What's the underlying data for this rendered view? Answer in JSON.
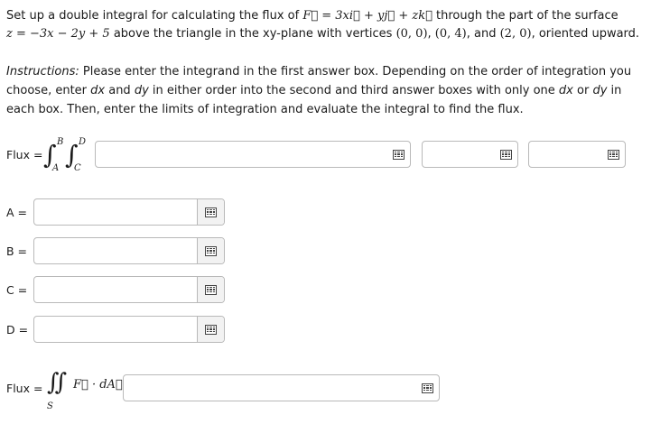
{
  "problem": {
    "line1_pre": "Set up a double integral for calculating the flux of ",
    "line1_field": "F⃗ = 3xi⃗ + yj⃗ + zk⃗",
    "line1_post": " through the part of the surface",
    "line2_eq": "z = −3x − 2y + 5",
    "line2_mid": " above the triangle in the xy-plane with vertices ",
    "v1": "(0, 0)",
    "v2": "(0, 4)",
    "and_word": "and",
    "v3": "(2, 0)",
    "line2_post": ", oriented upward."
  },
  "instructions": {
    "label": "Instructions:",
    "text_a": " Please enter the integrand in the first answer box. Depending on the order of integration you choose, enter ",
    "dx": "dx",
    "and_word": " and ",
    "dy": "dy",
    "text_b": " in either order into the second and third answer boxes with only one ",
    "dx2": "dx",
    "or_word": " or ",
    "dy2": "dy",
    "text_c": " in each box. Then, enter the limits of integration and evaluate the integral to find the flux."
  },
  "flux_row": {
    "label": "Flux =",
    "lim_B": "B",
    "lim_A": "A",
    "lim_D": "D",
    "lim_C": "C",
    "integrand_value": "",
    "d1_value": "",
    "d2_value": ""
  },
  "limits": [
    {
      "label": "A =",
      "value": ""
    },
    {
      "label": "B =",
      "value": ""
    },
    {
      "label": "C =",
      "value": ""
    },
    {
      "label": "D =",
      "value": ""
    }
  ],
  "final": {
    "label": "Flux =",
    "integral": "∬",
    "subscript": "S",
    "integrand": "F⃗ · dA⃗ =",
    "value": ""
  },
  "icons": {
    "keyboard": "keyboard-icon"
  }
}
